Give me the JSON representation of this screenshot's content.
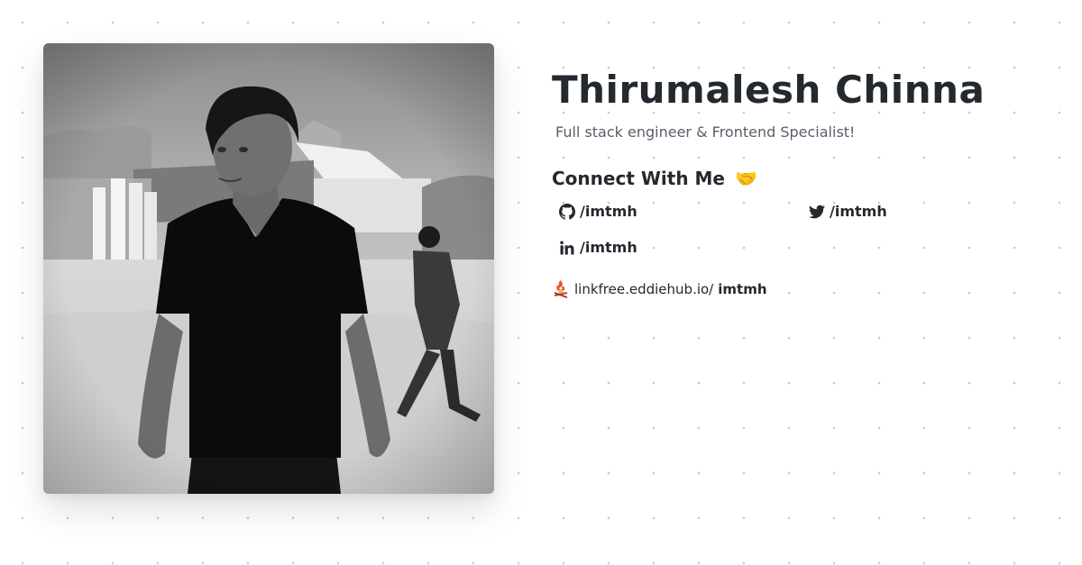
{
  "profile": {
    "name": "Thirumalesh Chinna",
    "tagline": "Full stack engineer & Frontend Specialist!",
    "photo_icon": "profile-photo"
  },
  "connect": {
    "title": "Connect With Me",
    "title_emoji": "🤝",
    "links": [
      {
        "platform": "github",
        "icon": "github-icon",
        "label": "/imtmh"
      },
      {
        "platform": "twitter",
        "icon": "twitter-icon",
        "label": "/imtmh"
      },
      {
        "platform": "linkedin",
        "icon": "linkedin-icon",
        "label": "/imtmh"
      }
    ]
  },
  "linkfree": {
    "icon": "linkfree-logo-icon",
    "domain": "linkfree.eddiehub.io/",
    "handle": "imtmh"
  },
  "colors": {
    "text": "#24292f",
    "muted": "#57606a",
    "dots": "#c9c9c9",
    "background": "#ffffff"
  }
}
